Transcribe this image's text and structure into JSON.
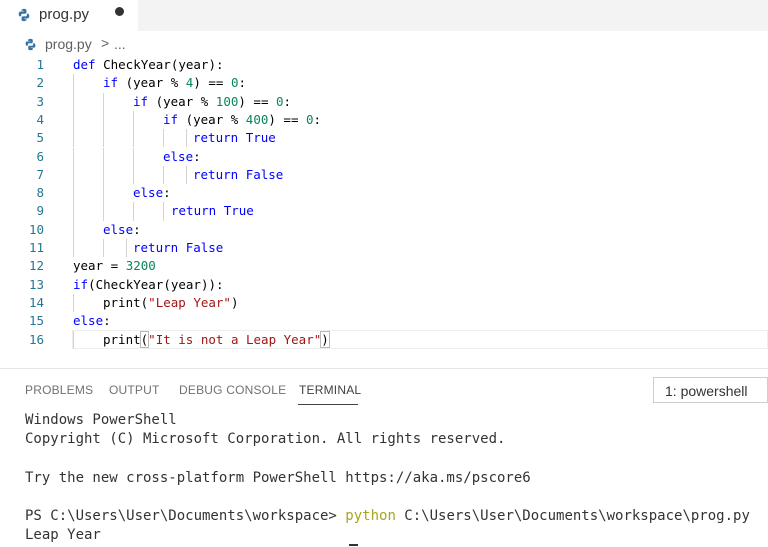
{
  "tab": {
    "label": "prog.py"
  },
  "breadcrumb": {
    "file": "prog.py",
    "separator": ">",
    "more": "..."
  },
  "editor": {
    "line_numbers": [
      "1",
      "2",
      "3",
      "4",
      "5",
      "6",
      "7",
      "8",
      "9",
      "10",
      "11",
      "12",
      "13",
      "14",
      "15",
      "16"
    ],
    "tokens": {
      "def": "def",
      "check_year_def": " CheckYear(year):",
      "if": "if",
      "else": "else",
      "return": "return",
      "true": "True",
      "false": "False",
      "print": "print",
      "l2_a": " (year % ",
      "l2_num": "4",
      "l2_b": ") == ",
      "zero": "0",
      "colon": ":",
      "l3_num": "100",
      "l4_num": "400",
      "l12_a": "year = ",
      "l12_num": "3200",
      "l13_a": "(CheckYear(year)):",
      "l14_str": "\"Leap Year\"",
      "l16_str": "\"It is not a Leap Year\"",
      "open_paren": "(",
      "close_paren": ")"
    }
  },
  "panel": {
    "tabs": [
      "PROBLEMS",
      "OUTPUT",
      "DEBUG CONSOLE",
      "TERMINAL"
    ],
    "active_tab": "TERMINAL",
    "shell_select": "1: powershell"
  },
  "terminal": {
    "line1": "Windows PowerShell",
    "line2": "Copyright (C) Microsoft Corporation. All rights reserved.",
    "line3": "Try the new cross-platform PowerShell https://aka.ms/pscore6",
    "prompt": "PS C:\\Users\\User\\Documents\\workspace> ",
    "cmd": "python",
    "cmd_arg": " C:\\Users\\User\\Documents\\workspace\\prog.py",
    "output": "Leap Year"
  },
  "colors": {
    "keyword": "#0000ff",
    "number": "#098658",
    "string": "#a31515",
    "line_number": "#237893",
    "terminal_command": "#a6a61e"
  }
}
